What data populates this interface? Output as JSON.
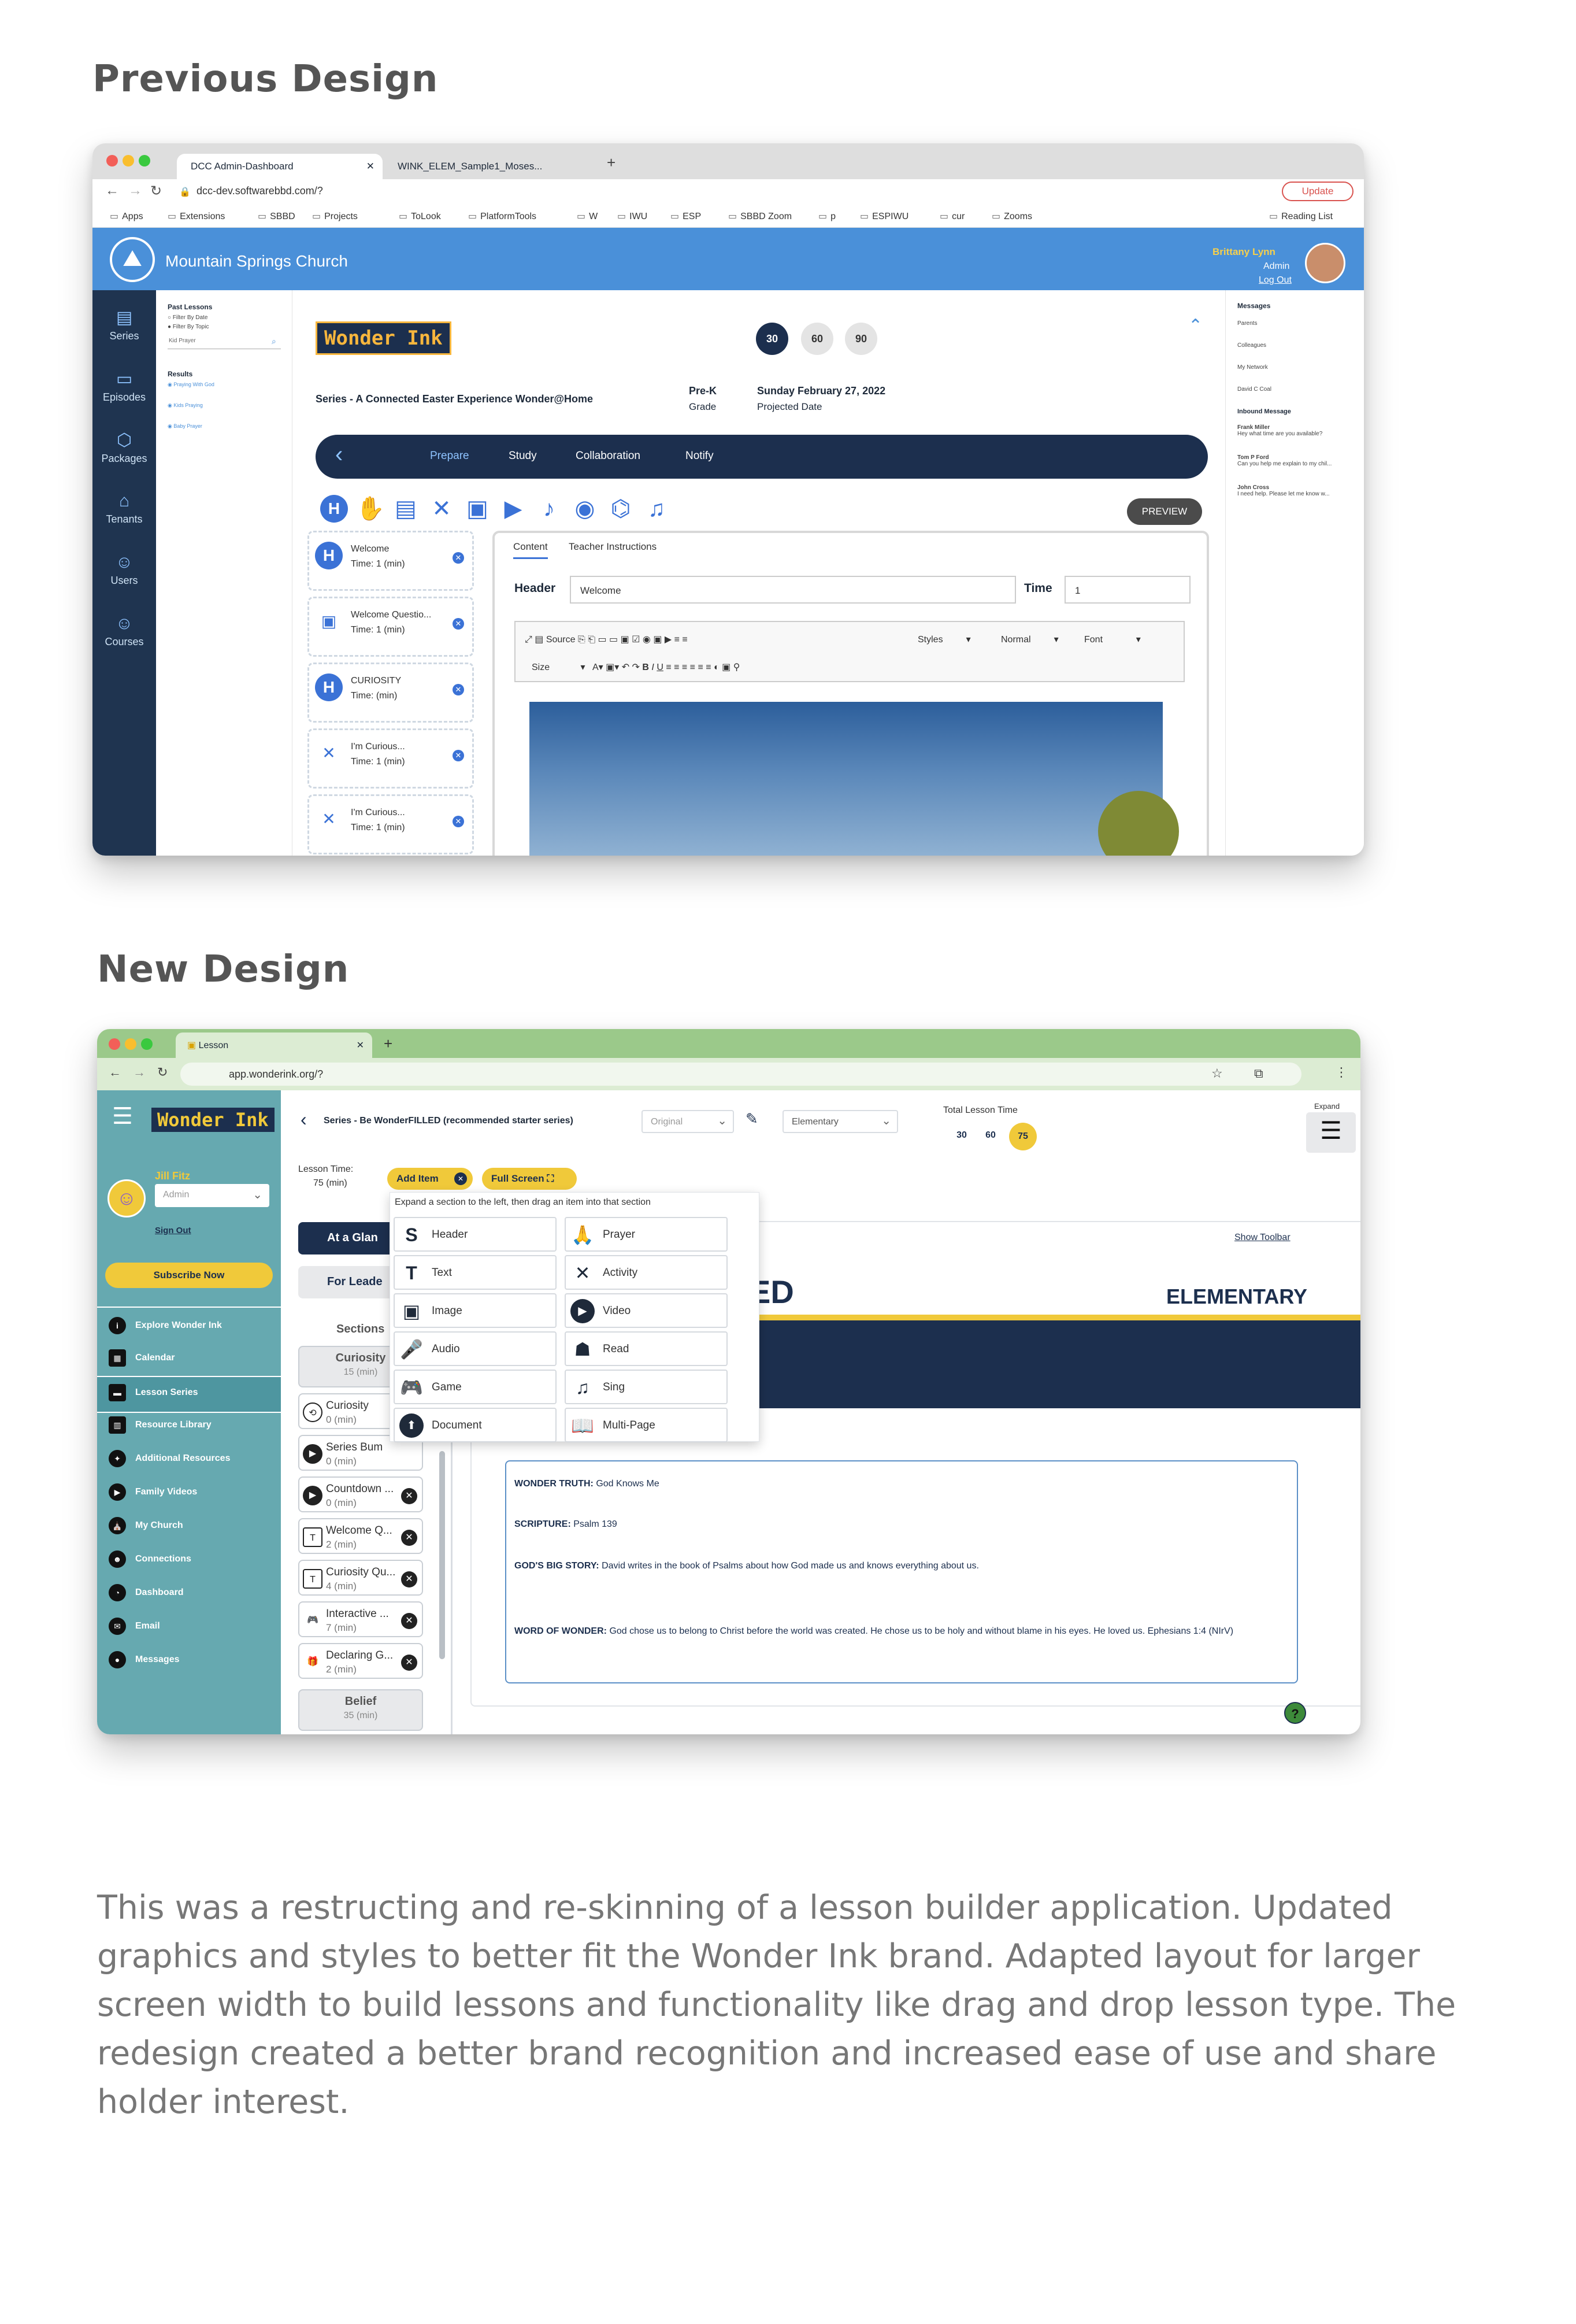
{
  "previous_heading": "Previous Design",
  "new_heading": "New Design",
  "description": "This was a restructing and re-skinning of a lesson builder application. Updated graphics and styles to better fit the Wonder Ink brand. Adapted layout for larger screen width to build lessons and functionality like drag and drop lesson type. The redesign created a better brand recognition and increased ease of use and share holder interest.",
  "old": {
    "tabs": [
      "DCC Admin-Dashboard",
      "WINK_ELEM_Sample1_Moses..."
    ],
    "url": "dcc-dev.softwarebbd.com/?",
    "update_label": "Update",
    "bookmarks": [
      "Apps",
      "Extensions",
      "SBBD",
      "Projects",
      "ToLook",
      "PlatformTools",
      "W",
      "IWU",
      "ESP",
      "SBBD Zoom",
      "p",
      "ESPIWU",
      "cur",
      "Zooms"
    ],
    "reading_list": "Reading List",
    "church_name": "Mountain Springs Church",
    "user_name": "Brittany Lynn",
    "user_role": "Admin",
    "logout": "Log Out",
    "nav": [
      "Series",
      "Episodes",
      "Packages",
      "Tenants",
      "Users",
      "Courses"
    ],
    "past_lessons": "Past Lessons",
    "filter_date": "Filter By Date",
    "filter_topic": "Filter By Topic",
    "search_placeholder": "Kid Prayer",
    "results_label": "Results",
    "results": [
      "Praying With God",
      "Kids Praying",
      "Baby Prayer"
    ],
    "logo": "Wonder Ink",
    "times": [
      "30",
      "60",
      "90"
    ],
    "series": "Series - A Connected Easter Experience Wonder@Home",
    "grade": "Pre-K",
    "grade_label": "Grade",
    "date": "Sunday February 27, 2022",
    "date_label": "Projected Date",
    "tabs_nav": [
      "Prepare",
      "Study",
      "Collaboration",
      "Notify"
    ],
    "preview": "PREVIEW",
    "cards": [
      {
        "icon": "H",
        "title": "Welcome",
        "time": "Time: 1 (min)"
      },
      {
        "icon": "▣",
        "title": "Welcome Questio...",
        "time": "Time: 1 (min)"
      },
      {
        "icon": "H",
        "title": "CURIOSITY",
        "time": "Time:   (min)"
      },
      {
        "icon": "✕",
        "title": "I'm Curious...",
        "time": "Time: 1 (min)"
      },
      {
        "icon": "✕",
        "title": "I'm Curious...",
        "time": "Time: 1 (min)"
      }
    ],
    "editor_tabs": [
      "Content",
      "Teacher Instructions"
    ],
    "header_label": "Header",
    "header_value": "Welcome",
    "time_label": "Time",
    "time_value": "1",
    "toolbar": {
      "source": "Source",
      "styles": "Styles",
      "normal": "Normal",
      "font": "Font",
      "size": "Size"
    },
    "messages_title": "Messages",
    "message_groups": [
      "Parents",
      "Colleagues",
      "My Network",
      "David C Coal"
    ],
    "inbound": "Inbound Message",
    "inbound_items": [
      {
        "name": "Frank Miller",
        "text": "Hey what time are you available?"
      },
      {
        "name": "Tom P Ford",
        "text": "Can you help me explain to my chil..."
      },
      {
        "name": "John Cross",
        "text": "I need help. Please let me know w..."
      }
    ]
  },
  "new": {
    "tab_title": "Lesson",
    "url": "app.wonderink.org/?",
    "logo": "Wonder Ink",
    "user_name": "Jill Fitz",
    "role_value": "Admin",
    "sign_out": "Sign Out",
    "subscribe": "Subscribe Now",
    "nav": [
      "Explore Wonder Ink",
      "Calendar",
      "Lesson Series",
      "Resource Library",
      "Additional Resources",
      "Family Videos",
      "My Church",
      "Connections",
      "Dashboard",
      "Email",
      "Messages"
    ],
    "series_title": "Series - Be WonderFILLED (recommended starter series)",
    "version_select": "Original",
    "grade_select": "Elementary",
    "total_time_label": "Total Lesson Time",
    "times": [
      "30",
      "60",
      "75"
    ],
    "expand_label": "Expand",
    "lesson_time_label": "Lesson Time:",
    "lesson_time_value": "75 (min)",
    "add_item": "Add Item",
    "full_screen": "Full Screen",
    "dropdown_hint": "Expand a section to the left, then drag an item into that section",
    "dropdown_items": [
      {
        "icon": "S",
        "label": "Header"
      },
      {
        "icon": "🙏",
        "label": "Prayer"
      },
      {
        "icon": "T",
        "label": "Text"
      },
      {
        "icon": "✕",
        "label": "Activity"
      },
      {
        "icon": "▣",
        "label": "Image"
      },
      {
        "icon": "▶",
        "label": "Video"
      },
      {
        "icon": "🎤",
        "label": "Audio"
      },
      {
        "icon": "☗",
        "label": "Read"
      },
      {
        "icon": "🎮",
        "label": "Game"
      },
      {
        "icon": "♫",
        "label": "Sing"
      },
      {
        "icon": "⬆",
        "label": "Document"
      },
      {
        "icon": "📖",
        "label": "Multi-Page"
      }
    ],
    "at_a_glance": "At a Glan",
    "for_leader": "For Leade",
    "sections_label": "Sections",
    "curiosity_group": "Curiosity",
    "curiosity_time": "15 (min)",
    "section_items": [
      {
        "icon": "⟲",
        "title": "Curiosity",
        "time": "0 (min)",
        "close": false
      },
      {
        "icon": "▶",
        "title": "Series Bum",
        "time": "0 (min)",
        "close": false
      },
      {
        "icon": "▶",
        "title": "Countdown ...",
        "time": "0 (min)",
        "close": true
      },
      {
        "icon": "T",
        "title": "Welcome Q...",
        "time": "2 (min)",
        "close": true
      },
      {
        "icon": "T",
        "title": "Curiosity Qu...",
        "time": "4 (min)",
        "close": true
      },
      {
        "icon": "🎮",
        "title": "Interactive ...",
        "time": "7 (min)",
        "close": true
      },
      {
        "icon": "🎁",
        "title": "Declaring G...",
        "time": "2 (min)",
        "close": true
      }
    ],
    "belief_group": "Belief",
    "belief_time": "35 (min)",
    "show_toolbar": "Show Toolbar",
    "banner_partial": "ED",
    "banner_grade": "ELEMENTARY",
    "content": [
      {
        "label": "WONDER TRUTH:",
        "text": "God Knows Me"
      },
      {
        "label": "SCRIPTURE:",
        "text": "Psalm 139"
      },
      {
        "label": "GOD'S BIG STORY:",
        "text": "David writes in the book of Psalms about how God made us and knows everything about us."
      },
      {
        "label": "WORD OF WONDER:",
        "text": "God chose us to belong to Christ before the world was created. He chose us to be holy and without blame in his eyes. He loved us. Ephesians 1:4 (NIrV)"
      }
    ],
    "help": "?"
  },
  "colors": {
    "old_header": "#4a90d9",
    "old_nav": "#1f3450",
    "navy": "#1c2f4e",
    "teal": "#66a9b0",
    "yellow": "#f0c93a",
    "chrome_green": "#9bc98a"
  }
}
